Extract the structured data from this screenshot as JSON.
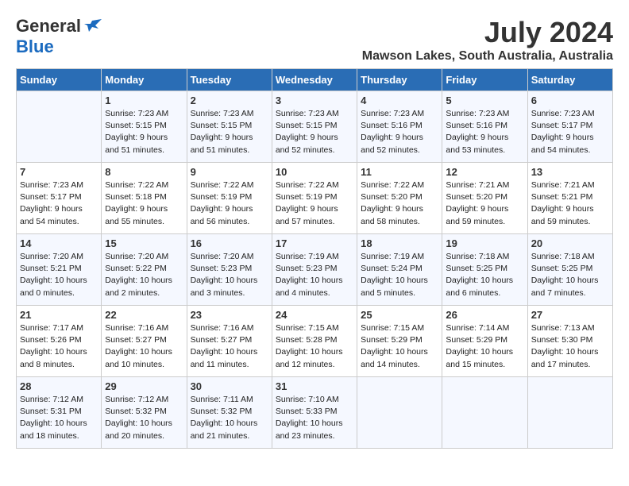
{
  "logo": {
    "general": "General",
    "blue": "Blue"
  },
  "title": {
    "month": "July 2024",
    "location": "Mawson Lakes, South Australia, Australia"
  },
  "days_of_week": [
    "Sunday",
    "Monday",
    "Tuesday",
    "Wednesday",
    "Thursday",
    "Friday",
    "Saturday"
  ],
  "weeks": [
    [
      {
        "num": "",
        "info": ""
      },
      {
        "num": "1",
        "info": "Sunrise: 7:23 AM\nSunset: 5:15 PM\nDaylight: 9 hours\nand 51 minutes."
      },
      {
        "num": "2",
        "info": "Sunrise: 7:23 AM\nSunset: 5:15 PM\nDaylight: 9 hours\nand 51 minutes."
      },
      {
        "num": "3",
        "info": "Sunrise: 7:23 AM\nSunset: 5:15 PM\nDaylight: 9 hours\nand 52 minutes."
      },
      {
        "num": "4",
        "info": "Sunrise: 7:23 AM\nSunset: 5:16 PM\nDaylight: 9 hours\nand 52 minutes."
      },
      {
        "num": "5",
        "info": "Sunrise: 7:23 AM\nSunset: 5:16 PM\nDaylight: 9 hours\nand 53 minutes."
      },
      {
        "num": "6",
        "info": "Sunrise: 7:23 AM\nSunset: 5:17 PM\nDaylight: 9 hours\nand 54 minutes."
      }
    ],
    [
      {
        "num": "7",
        "info": "Sunrise: 7:23 AM\nSunset: 5:17 PM\nDaylight: 9 hours\nand 54 minutes."
      },
      {
        "num": "8",
        "info": "Sunrise: 7:22 AM\nSunset: 5:18 PM\nDaylight: 9 hours\nand 55 minutes."
      },
      {
        "num": "9",
        "info": "Sunrise: 7:22 AM\nSunset: 5:19 PM\nDaylight: 9 hours\nand 56 minutes."
      },
      {
        "num": "10",
        "info": "Sunrise: 7:22 AM\nSunset: 5:19 PM\nDaylight: 9 hours\nand 57 minutes."
      },
      {
        "num": "11",
        "info": "Sunrise: 7:22 AM\nSunset: 5:20 PM\nDaylight: 9 hours\nand 58 minutes."
      },
      {
        "num": "12",
        "info": "Sunrise: 7:21 AM\nSunset: 5:20 PM\nDaylight: 9 hours\nand 59 minutes."
      },
      {
        "num": "13",
        "info": "Sunrise: 7:21 AM\nSunset: 5:21 PM\nDaylight: 9 hours\nand 59 minutes."
      }
    ],
    [
      {
        "num": "14",
        "info": "Sunrise: 7:20 AM\nSunset: 5:21 PM\nDaylight: 10 hours\nand 0 minutes."
      },
      {
        "num": "15",
        "info": "Sunrise: 7:20 AM\nSunset: 5:22 PM\nDaylight: 10 hours\nand 2 minutes."
      },
      {
        "num": "16",
        "info": "Sunrise: 7:20 AM\nSunset: 5:23 PM\nDaylight: 10 hours\nand 3 minutes."
      },
      {
        "num": "17",
        "info": "Sunrise: 7:19 AM\nSunset: 5:23 PM\nDaylight: 10 hours\nand 4 minutes."
      },
      {
        "num": "18",
        "info": "Sunrise: 7:19 AM\nSunset: 5:24 PM\nDaylight: 10 hours\nand 5 minutes."
      },
      {
        "num": "19",
        "info": "Sunrise: 7:18 AM\nSunset: 5:25 PM\nDaylight: 10 hours\nand 6 minutes."
      },
      {
        "num": "20",
        "info": "Sunrise: 7:18 AM\nSunset: 5:25 PM\nDaylight: 10 hours\nand 7 minutes."
      }
    ],
    [
      {
        "num": "21",
        "info": "Sunrise: 7:17 AM\nSunset: 5:26 PM\nDaylight: 10 hours\nand 8 minutes."
      },
      {
        "num": "22",
        "info": "Sunrise: 7:16 AM\nSunset: 5:27 PM\nDaylight: 10 hours\nand 10 minutes."
      },
      {
        "num": "23",
        "info": "Sunrise: 7:16 AM\nSunset: 5:27 PM\nDaylight: 10 hours\nand 11 minutes."
      },
      {
        "num": "24",
        "info": "Sunrise: 7:15 AM\nSunset: 5:28 PM\nDaylight: 10 hours\nand 12 minutes."
      },
      {
        "num": "25",
        "info": "Sunrise: 7:15 AM\nSunset: 5:29 PM\nDaylight: 10 hours\nand 14 minutes."
      },
      {
        "num": "26",
        "info": "Sunrise: 7:14 AM\nSunset: 5:29 PM\nDaylight: 10 hours\nand 15 minutes."
      },
      {
        "num": "27",
        "info": "Sunrise: 7:13 AM\nSunset: 5:30 PM\nDaylight: 10 hours\nand 17 minutes."
      }
    ],
    [
      {
        "num": "28",
        "info": "Sunrise: 7:12 AM\nSunset: 5:31 PM\nDaylight: 10 hours\nand 18 minutes."
      },
      {
        "num": "29",
        "info": "Sunrise: 7:12 AM\nSunset: 5:32 PM\nDaylight: 10 hours\nand 20 minutes."
      },
      {
        "num": "30",
        "info": "Sunrise: 7:11 AM\nSunset: 5:32 PM\nDaylight: 10 hours\nand 21 minutes."
      },
      {
        "num": "31",
        "info": "Sunrise: 7:10 AM\nSunset: 5:33 PM\nDaylight: 10 hours\nand 23 minutes."
      },
      {
        "num": "",
        "info": ""
      },
      {
        "num": "",
        "info": ""
      },
      {
        "num": "",
        "info": ""
      }
    ]
  ]
}
